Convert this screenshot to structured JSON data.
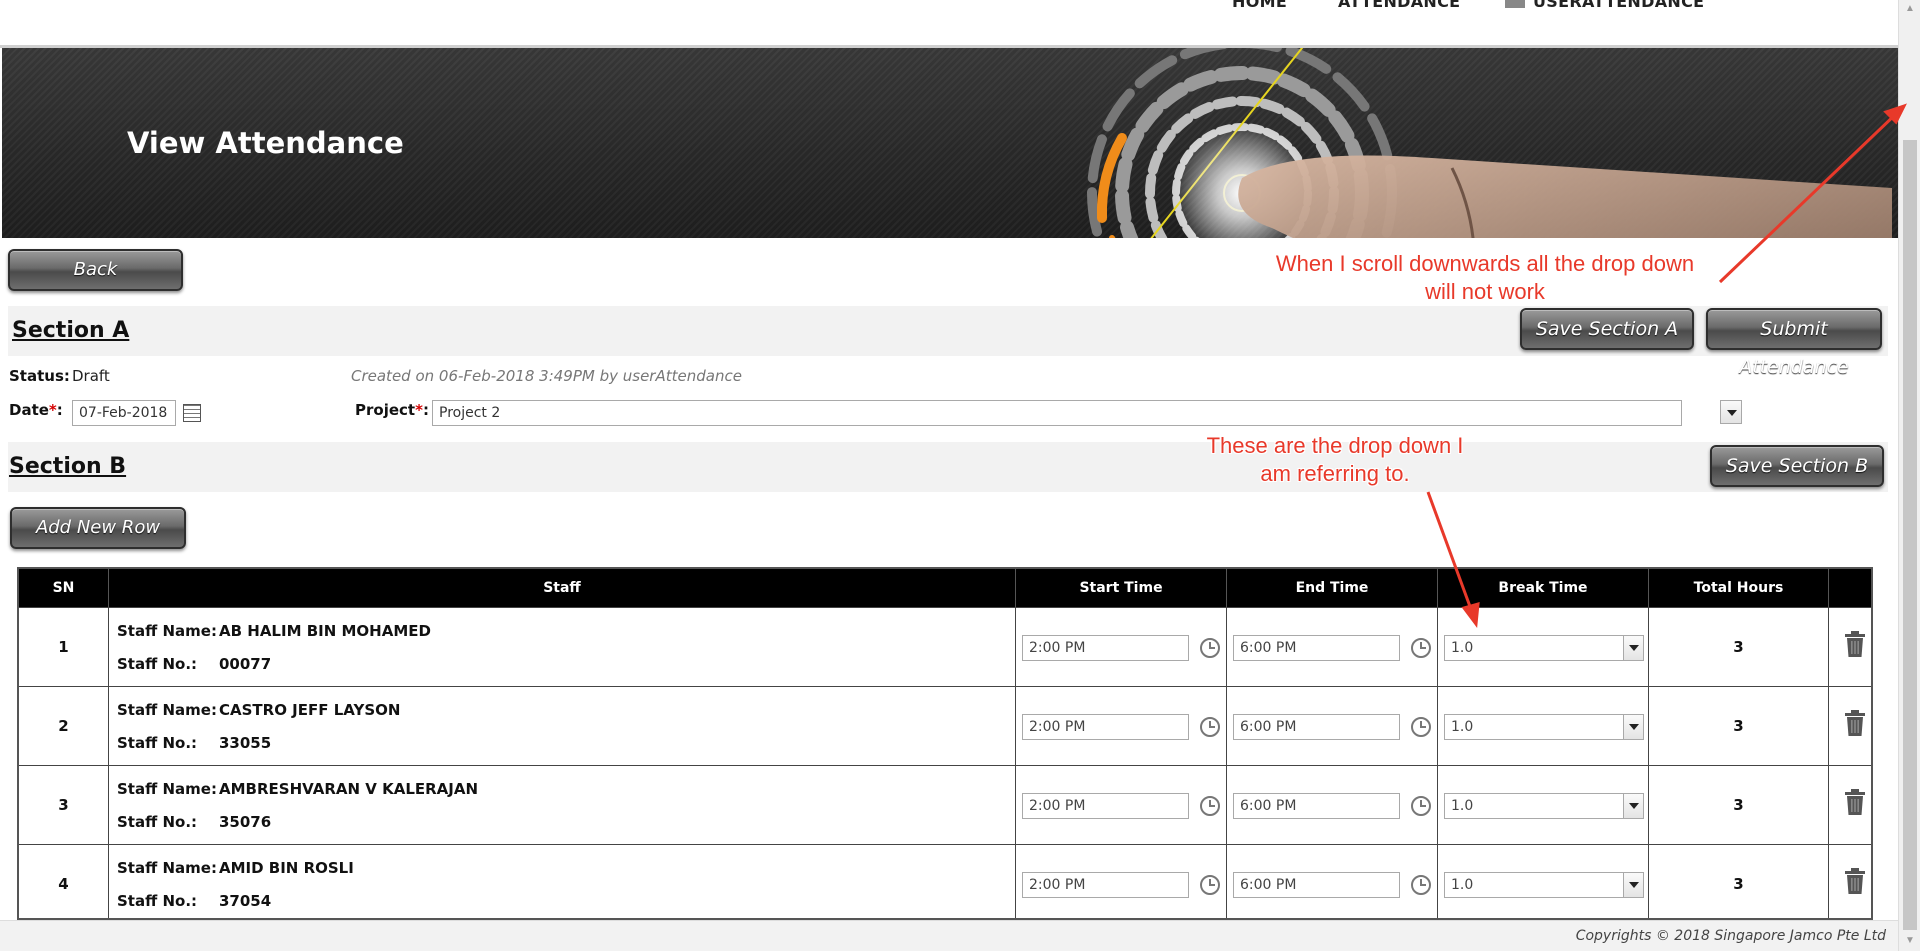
{
  "nav": {
    "items": [
      {
        "label": "HOME"
      },
      {
        "label": "ATTENDANCE"
      },
      {
        "label": "USERATTENDANCE"
      }
    ]
  },
  "banner": {
    "title": "View Attendance"
  },
  "buttons": {
    "back": "Back",
    "save_section_a": "Save Section A",
    "submit_attendance": "Submit Attendance",
    "save_section_b": "Save Section B",
    "add_new_row": "Add New Row"
  },
  "section_a": {
    "title": "Section A",
    "status_label": "Status:",
    "status_value": "Draft",
    "created_info": "Created on 06-Feb-2018 3:49PM by userAttendance",
    "date_label": "Date",
    "date_value": "07-Feb-2018",
    "project_label": "Project",
    "project_value": "Project 2",
    "required_mark": "*",
    "colon": ":"
  },
  "section_b": {
    "title": "Section B"
  },
  "table": {
    "headers": {
      "sn": "SN",
      "staff": "Staff",
      "start": "Start Time",
      "end": "End Time",
      "break": "Break Time",
      "total": "Total Hours"
    },
    "staff_name_label": "Staff Name:",
    "staff_no_label": "Staff No.:",
    "rows": [
      {
        "sn": "1",
        "name": "AB HALIM BIN MOHAMED",
        "no": "00077",
        "start": "2:00 PM",
        "end": "6:00 PM",
        "break": "1.0",
        "total": "3"
      },
      {
        "sn": "2",
        "name": "CASTRO JEFF LAYSON",
        "no": "33055",
        "start": "2:00 PM",
        "end": "6:00 PM",
        "break": "1.0",
        "total": "3"
      },
      {
        "sn": "3",
        "name": "AMBRESHVARAN V KALERAJAN",
        "no": "35076",
        "start": "2:00 PM",
        "end": "6:00 PM",
        "break": "1.0",
        "total": "3"
      },
      {
        "sn": "4",
        "name": "AMID BIN ROSLI",
        "no": "37054",
        "start": "2:00 PM",
        "end": "6:00 PM",
        "break": "1.0",
        "total": "3"
      }
    ]
  },
  "footer": {
    "copyright": "Copyrights © 2018 Singapore Jamco Pte Ltd"
  },
  "annotations": {
    "scroll_line1": "When I scroll downwards all the drop down",
    "scroll_line2": "will not work",
    "dropdown_line1": "These are the drop down I",
    "dropdown_line2": "am referring to."
  },
  "colors": {
    "annotation": "#e8392a",
    "required": "#d40000",
    "table_header": "#000000"
  }
}
